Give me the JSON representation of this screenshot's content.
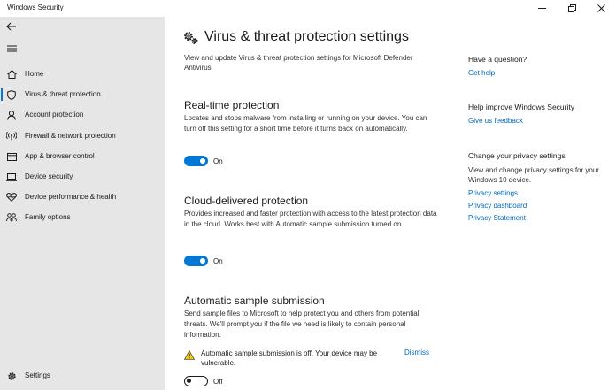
{
  "window": {
    "title": "Windows Security",
    "controls": [
      "minimize-icon",
      "restore-icon",
      "close-icon"
    ]
  },
  "sidebar": {
    "top_icons": [
      "back-arrow-icon",
      "hamburger-menu-icon"
    ],
    "items": [
      {
        "label": "Home",
        "icon": "home-icon"
      },
      {
        "label": "Virus & threat protection",
        "icon": "shield-icon",
        "active": true
      },
      {
        "label": "Account protection",
        "icon": "person-icon"
      },
      {
        "label": "Firewall & network protection",
        "icon": "wifi-antenna-icon"
      },
      {
        "label": "App & browser control",
        "icon": "browser-window-icon"
      },
      {
        "label": "Device security",
        "icon": "laptop-icon"
      },
      {
        "label": "Device performance & health",
        "icon": "heart-icon"
      },
      {
        "label": "Family options",
        "icon": "family-icon"
      }
    ],
    "settings": {
      "label": "Settings",
      "icon": "gear-icon"
    }
  },
  "main": {
    "title": "Virus & threat protection settings",
    "title_icon": "gears-icon",
    "description": "View and update Virus & threat protection settings for Microsoft Defender Antivirus.",
    "sections": [
      {
        "title": "Real-time protection",
        "description": "Locates and stops malware from installing or running on your device. You can turn off this setting for a short time before it turns back on automatically.",
        "toggle_state": "On",
        "on": true
      },
      {
        "title": "Cloud-delivered protection",
        "description": "Provides increased and faster protection with access to the latest protection data in the cloud. Works best with Automatic sample submission turned on.",
        "toggle_state": "On",
        "on": true
      },
      {
        "title": "Automatic sample submission",
        "description": "Send sample files to Microsoft to help protect you and others from potential threats. We'll prompt you if the file we need is likely to contain personal information.",
        "toggle_state": "Off",
        "on": false
      }
    ],
    "warning": {
      "icon": "warning-triangle-icon",
      "text": "Automatic sample submission is off. Your device may be vulnerable.",
      "dismiss_label": "Dismiss"
    }
  },
  "aside": {
    "question": {
      "heading": "Have a question?",
      "link": "Get help"
    },
    "improve": {
      "heading": "Help improve Windows Security",
      "link": "Give us feedback"
    },
    "privacy": {
      "heading": "Change your privacy settings",
      "text": "View and change privacy settings for your Windows 10 device.",
      "links": [
        "Privacy settings",
        "Privacy dashboard",
        "Privacy Statement"
      ]
    }
  },
  "colors": {
    "accent": "#0078d4",
    "link": "#0067b8",
    "sidebar_bg": "#e6e6e6",
    "warning": "#f2c811"
  }
}
